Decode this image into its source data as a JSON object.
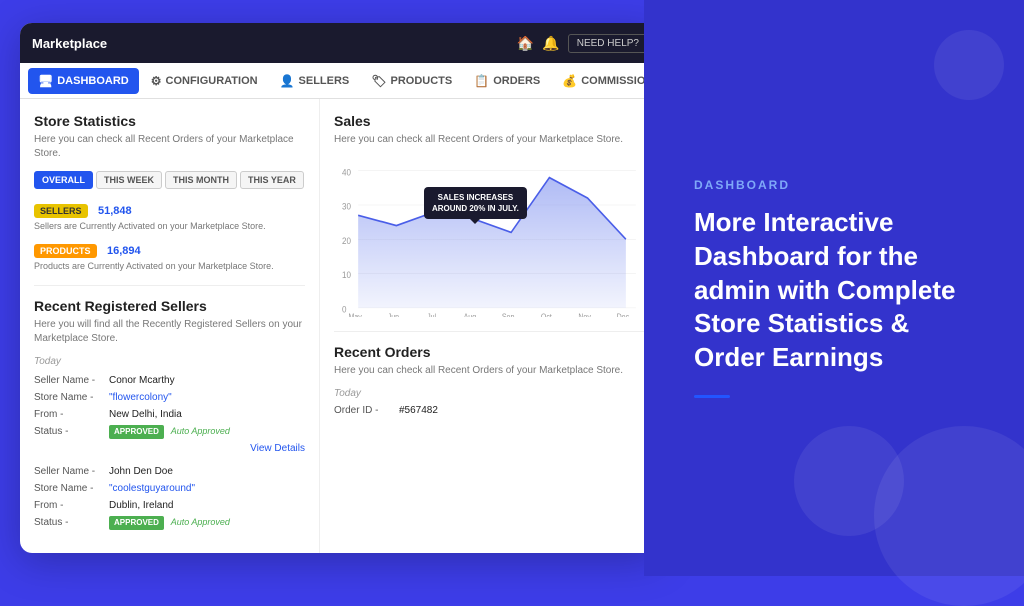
{
  "right_panel": {
    "label": "DASHBOARD",
    "heading": "More Interactive Dashboard for the admin with Complete Store Statistics & Order Earnings"
  },
  "nav": {
    "brand": "Marketplace",
    "need_help": "NEED HELP?",
    "items": [
      {
        "label": "DASHBOARD",
        "icon": "🖥",
        "active": true
      },
      {
        "label": "CONFIGURATION",
        "icon": "⚙",
        "active": false
      },
      {
        "label": "SELLERS",
        "icon": "👤",
        "active": false
      },
      {
        "label": "PRODUCTS",
        "icon": "🏷",
        "active": false
      },
      {
        "label": "ORDERS",
        "icon": "📋",
        "active": false
      },
      {
        "label": "COMMISSION",
        "icon": "💰",
        "active": false
      },
      {
        "label": "...",
        "icon": "",
        "active": false
      }
    ]
  },
  "store_statistics": {
    "title": "Store Statistics",
    "desc": "Here you can check all Recent Orders of your Marketplace Store.",
    "filters": [
      "OVERALL",
      "THIS WEEK",
      "THIS MONTH",
      "THIS YEAR"
    ],
    "active_filter": 0,
    "sellers": {
      "badge": "SELLERS",
      "value": "51,848",
      "desc": "Sellers are Currently Activated on your Marketplace Store."
    },
    "products": {
      "badge": "PRODUCTS",
      "value": "16,894",
      "desc": "Products are Currently Activated on your Marketplace Store."
    }
  },
  "recent_sellers": {
    "title": "Recent Registered Sellers",
    "desc": "Here you will find all the Recently Registered Sellers on your Marketplace Store.",
    "today_label": "Today",
    "sellers": [
      {
        "seller_name_lbl": "Seller Name -",
        "seller_name": "Conor Mcarthy",
        "store_name_lbl": "Store Name -",
        "store_name": "\"flowercolony\"",
        "from_lbl": "From -",
        "from": "New Delhi, India",
        "status_lbl": "Status -",
        "status": "APPROVED",
        "status_note": "Auto Approved",
        "view_details": "View Details"
      },
      {
        "seller_name_lbl": "Seller Name -",
        "seller_name": "John Den Doe",
        "store_name_lbl": "Store Name -",
        "store_name": "\"coolestguyaround\"",
        "from_lbl": "From -",
        "from": "Dublin, Ireland",
        "status_lbl": "Status -",
        "status": "APPROVED",
        "status_note": "Auto Approved"
      }
    ]
  },
  "sales": {
    "title": "Sales",
    "desc": "Here you can check all Recent Orders of your Marketplace Store.",
    "tooltip": "SALES INCREASES\nAROUND 20% IN JULY.",
    "x_labels": [
      "May",
      "Jun",
      "Jul",
      "Aug",
      "Sep",
      "Oct",
      "Nov",
      "Dec"
    ],
    "y_labels": [
      "0",
      "10",
      "20",
      "30",
      "40"
    ],
    "chart_points": [
      {
        "x": 0,
        "y": 27
      },
      {
        "x": 1,
        "y": 24
      },
      {
        "x": 2,
        "y": 28
      },
      {
        "x": 3,
        "y": 26
      },
      {
        "x": 4,
        "y": 22
      },
      {
        "x": 5,
        "y": 38
      },
      {
        "x": 6,
        "y": 32
      },
      {
        "x": 7,
        "y": 20
      }
    ]
  },
  "recent_orders": {
    "title": "Recent Orders",
    "desc": "Here you can check all Recent Orders of your Marketplace Store.",
    "today_label": "Today",
    "orders": [
      {
        "order_id_lbl": "Order ID -",
        "order_id": "#567482"
      }
    ]
  }
}
